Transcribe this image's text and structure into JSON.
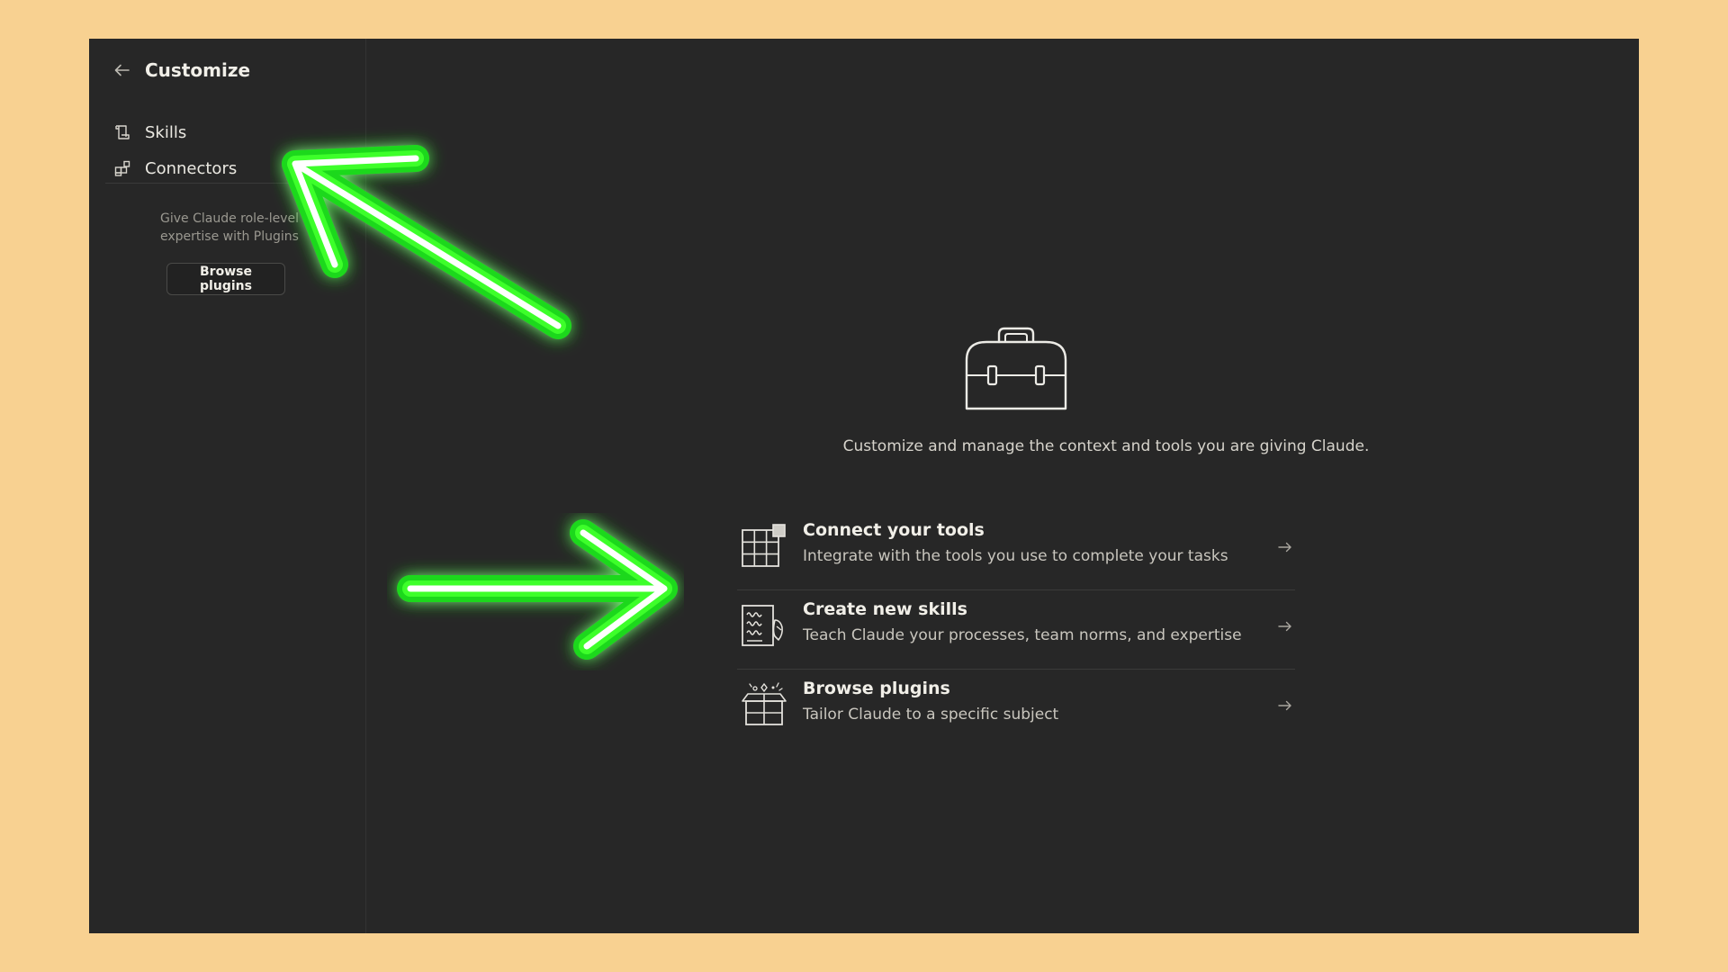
{
  "sidebar": {
    "title": "Customize",
    "items": [
      {
        "label": "Skills",
        "icon": "skills-icon"
      },
      {
        "label": "Connectors",
        "icon": "connectors-icon"
      }
    ],
    "promo": {
      "text": "Give Claude role-level expertise with Plugins",
      "button_label": "Browse plugins"
    }
  },
  "main": {
    "hero_icon": "toolbox-icon",
    "hero_text": "Customize and manage the context and tools you are giving Claude.",
    "options": [
      {
        "title": "Connect your tools",
        "description": "Integrate with the tools you use to complete your tasks",
        "icon": "grid-tools-icon"
      },
      {
        "title": "Create new skills",
        "description": "Teach Claude your processes, team norms, and expertise",
        "icon": "skills-document-icon"
      },
      {
        "title": "Browse plugins",
        "description": "Tailor Claude to a specific subject",
        "icon": "gift-box-icon"
      }
    ]
  },
  "colors": {
    "background": "#f8d191",
    "panel": "#272727",
    "annotation_arrow": "#2dff1a"
  }
}
